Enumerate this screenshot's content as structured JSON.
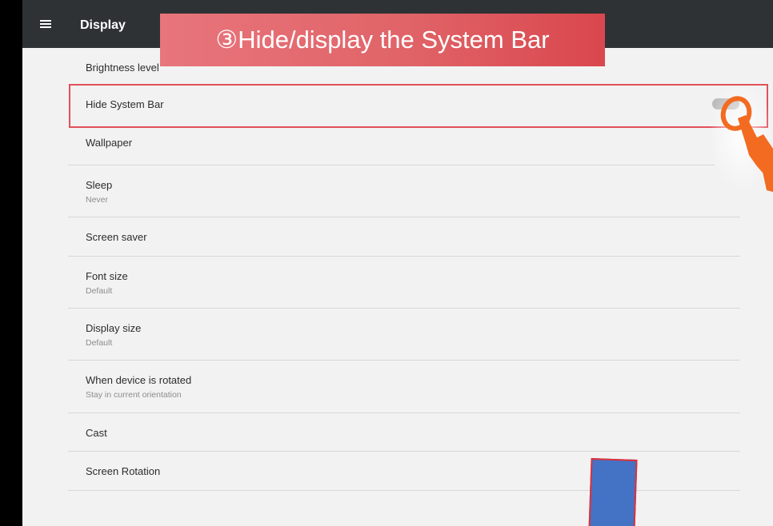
{
  "appbar": {
    "menu_icon": "hamburger-menu-icon",
    "title": "Display"
  },
  "callout": {
    "text": "③Hide/display the System Bar",
    "color": "#e06468"
  },
  "settings": {
    "brightness": {
      "title": "Brightness level"
    },
    "hide_system_bar": {
      "title": "Hide System Bar",
      "toggle_state": "off"
    },
    "wallpaper": {
      "title": "Wallpaper"
    },
    "sleep": {
      "title": "Sleep",
      "summary": "Never"
    },
    "screen_saver": {
      "title": "Screen saver"
    },
    "font_size": {
      "title": "Font size",
      "summary": "Default"
    },
    "display_size": {
      "title": "Display size",
      "summary": "Default"
    },
    "rotation": {
      "title": "When device is rotated",
      "summary": "Stay in current orientation"
    },
    "cast": {
      "title": "Cast"
    },
    "screen_rotation": {
      "title": "Screen Rotation"
    }
  },
  "annotations": {
    "highlight_color": "#e2505a",
    "hand_icon": "pointing-hand-icon",
    "hand_color": "#f26b21",
    "arrow_color": "#4472c4"
  }
}
